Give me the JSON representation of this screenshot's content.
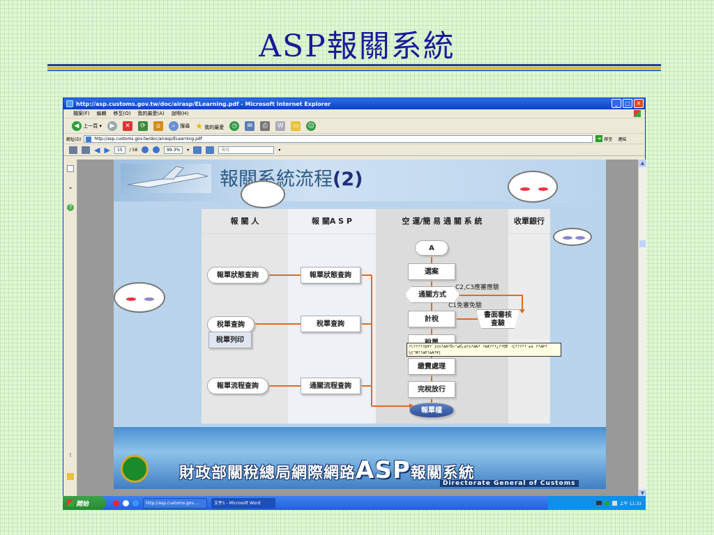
{
  "slide": {
    "title": "ASP報關系統"
  },
  "browser": {
    "title": "http://asp.customs.gov.tw/doc/airasp/ELearning.pdf - Microsoft Internet Explorer",
    "menu": [
      "檔案(F)",
      "編輯",
      "移至(O)",
      "我的最愛(A)",
      "說明(H)"
    ],
    "toolbar": {
      "back": "上一頁",
      "search": "搜尋",
      "favorites": "我的最愛"
    },
    "address": {
      "label": "網址(D)",
      "url": "http://asp.customs.gov.tw/doc/airasp/ELearning.pdf",
      "go": "移至",
      "links": "連結"
    },
    "pdf": {
      "page_current": "15",
      "page_total": "/ 58",
      "zoom": "99.3%",
      "find_placeholder": "尋找"
    }
  },
  "doc": {
    "title": "報關系統流程",
    "title_num": "(2)",
    "lanes": [
      "報 關 人",
      "報 關A S P",
      "空 運/簡 易 通 關 系 統",
      "收單銀行"
    ],
    "left_nodes": [
      "報單狀態查詢",
      "稅單查詢",
      "稅單列印",
      "報單流程查詢"
    ],
    "mid_nodes": [
      "報單狀態查詢",
      "稅單查詢",
      "通關流程查詢"
    ],
    "right_nodes": [
      "A",
      "選案",
      "通關方式",
      "計稅",
      "稅單",
      "繳費處理",
      "完稅放行",
      "報單檔"
    ],
    "review_node": "書面審核\n查驗",
    "hints": [
      "C2,C3應審應驗",
      "C1免審免驗"
    ],
    "tooltip": "?\\?????p¥?`]cn?áA?Ö»\"±Ü¡q?s?ãA? ?áA???¿??ÕÉ -Ç????? ±¢ ??áP?¼{\"M??áP?áA?¥]",
    "footer": {
      "main_pre": "財政部關稅總局網際網路",
      "asp": "ASP",
      "main_post": "報關系統",
      "sub": "Directorate General of Customs"
    }
  },
  "taskbar": {
    "start": "開始",
    "tasks": [
      "http://asp.customs.gov....",
      "文件1 - Microsoft Word"
    ],
    "clock": "上午 11:33"
  }
}
